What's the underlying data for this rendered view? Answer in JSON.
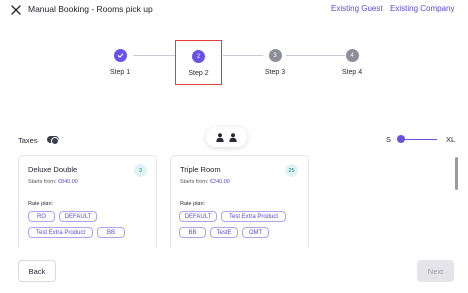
{
  "header": {
    "title": "Manual Booking - Rooms pick up",
    "links": [
      "Existing Guest",
      "Existing Company"
    ]
  },
  "stepper": {
    "steps": [
      {
        "label": "Step 1",
        "number": "1",
        "state": "done"
      },
      {
        "label": "Step 2",
        "number": "2",
        "state": "active"
      },
      {
        "label": "Step 3",
        "number": "3",
        "state": "todo"
      },
      {
        "label": "Step 4",
        "number": "4",
        "state": "todo"
      }
    ]
  },
  "toolbar": {
    "taxes_label": "Taxes",
    "taxes_enabled": true,
    "size_small": "S",
    "size_large": "XL",
    "size_value": 0.0
  },
  "cards": [
    {
      "title": "Deluxe Double",
      "count": "3",
      "starts_prefix": "Starts from: ",
      "price": "€840.00",
      "rate_plan_label": "Rate plan:",
      "rate_plans": [
        "RO",
        "DEFAULT",
        "Test Extra Product",
        "BB"
      ]
    },
    {
      "title": "Triple Room",
      "count": "25",
      "starts_prefix": "Starts from: ",
      "price": "€240.00",
      "rate_plan_label": "Rate plan:",
      "rate_plans": [
        "DEFAULT",
        "Test Extra Product",
        "BB",
        "TestE",
        "OMT"
      ]
    }
  ],
  "footer": {
    "back_label": "Back",
    "next_label": "Next"
  },
  "colors": {
    "accent": "#6a52e8",
    "link": "#5b4bd6",
    "highlight_border": "#e23c3c"
  }
}
